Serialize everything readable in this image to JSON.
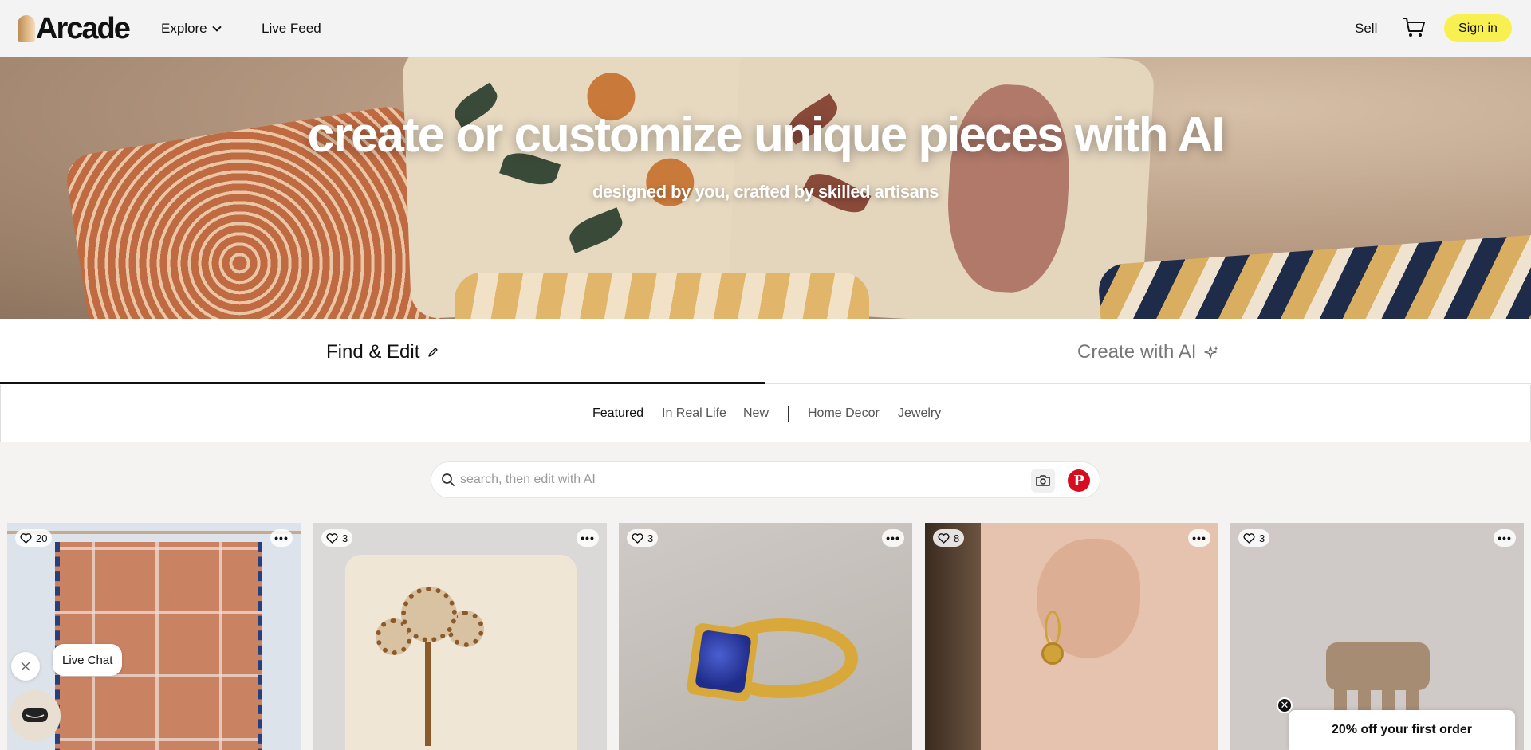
{
  "header": {
    "logo_text": "Arcade",
    "nav": {
      "explore": "Explore",
      "live_feed": "Live Feed"
    },
    "sell": "Sell",
    "sign_in": "Sign in"
  },
  "hero": {
    "title": "create or customize unique pieces with AI",
    "subtitle": "designed by you, crafted by skilled artisans"
  },
  "modes": {
    "find_edit": "Find & Edit",
    "create_ai": "Create with AI",
    "active": "find_edit"
  },
  "filters": [
    "Featured",
    "In Real Life",
    "New",
    "Home Decor",
    "Jewelry"
  ],
  "search": {
    "placeholder": "search, then edit with AI",
    "value": "",
    "pinterest_label": "P"
  },
  "products": [
    {
      "likes": "20",
      "image": "woven-rug"
    },
    {
      "likes": "3",
      "image": "floral-pillow"
    },
    {
      "likes": "3",
      "image": "lapis-gold-ring"
    },
    {
      "likes": "8",
      "image": "gold-coin-earring"
    },
    {
      "likes": "3",
      "image": "ceramic-horse-figurine"
    }
  ],
  "more_label": "•••",
  "widgets": {
    "live_chat": "Live Chat",
    "promo": "20% off your first order",
    "promo_close": "✕"
  },
  "colors": {
    "accent": "#f7f050",
    "pinterest": "#d50d1e",
    "text": "#111111"
  }
}
